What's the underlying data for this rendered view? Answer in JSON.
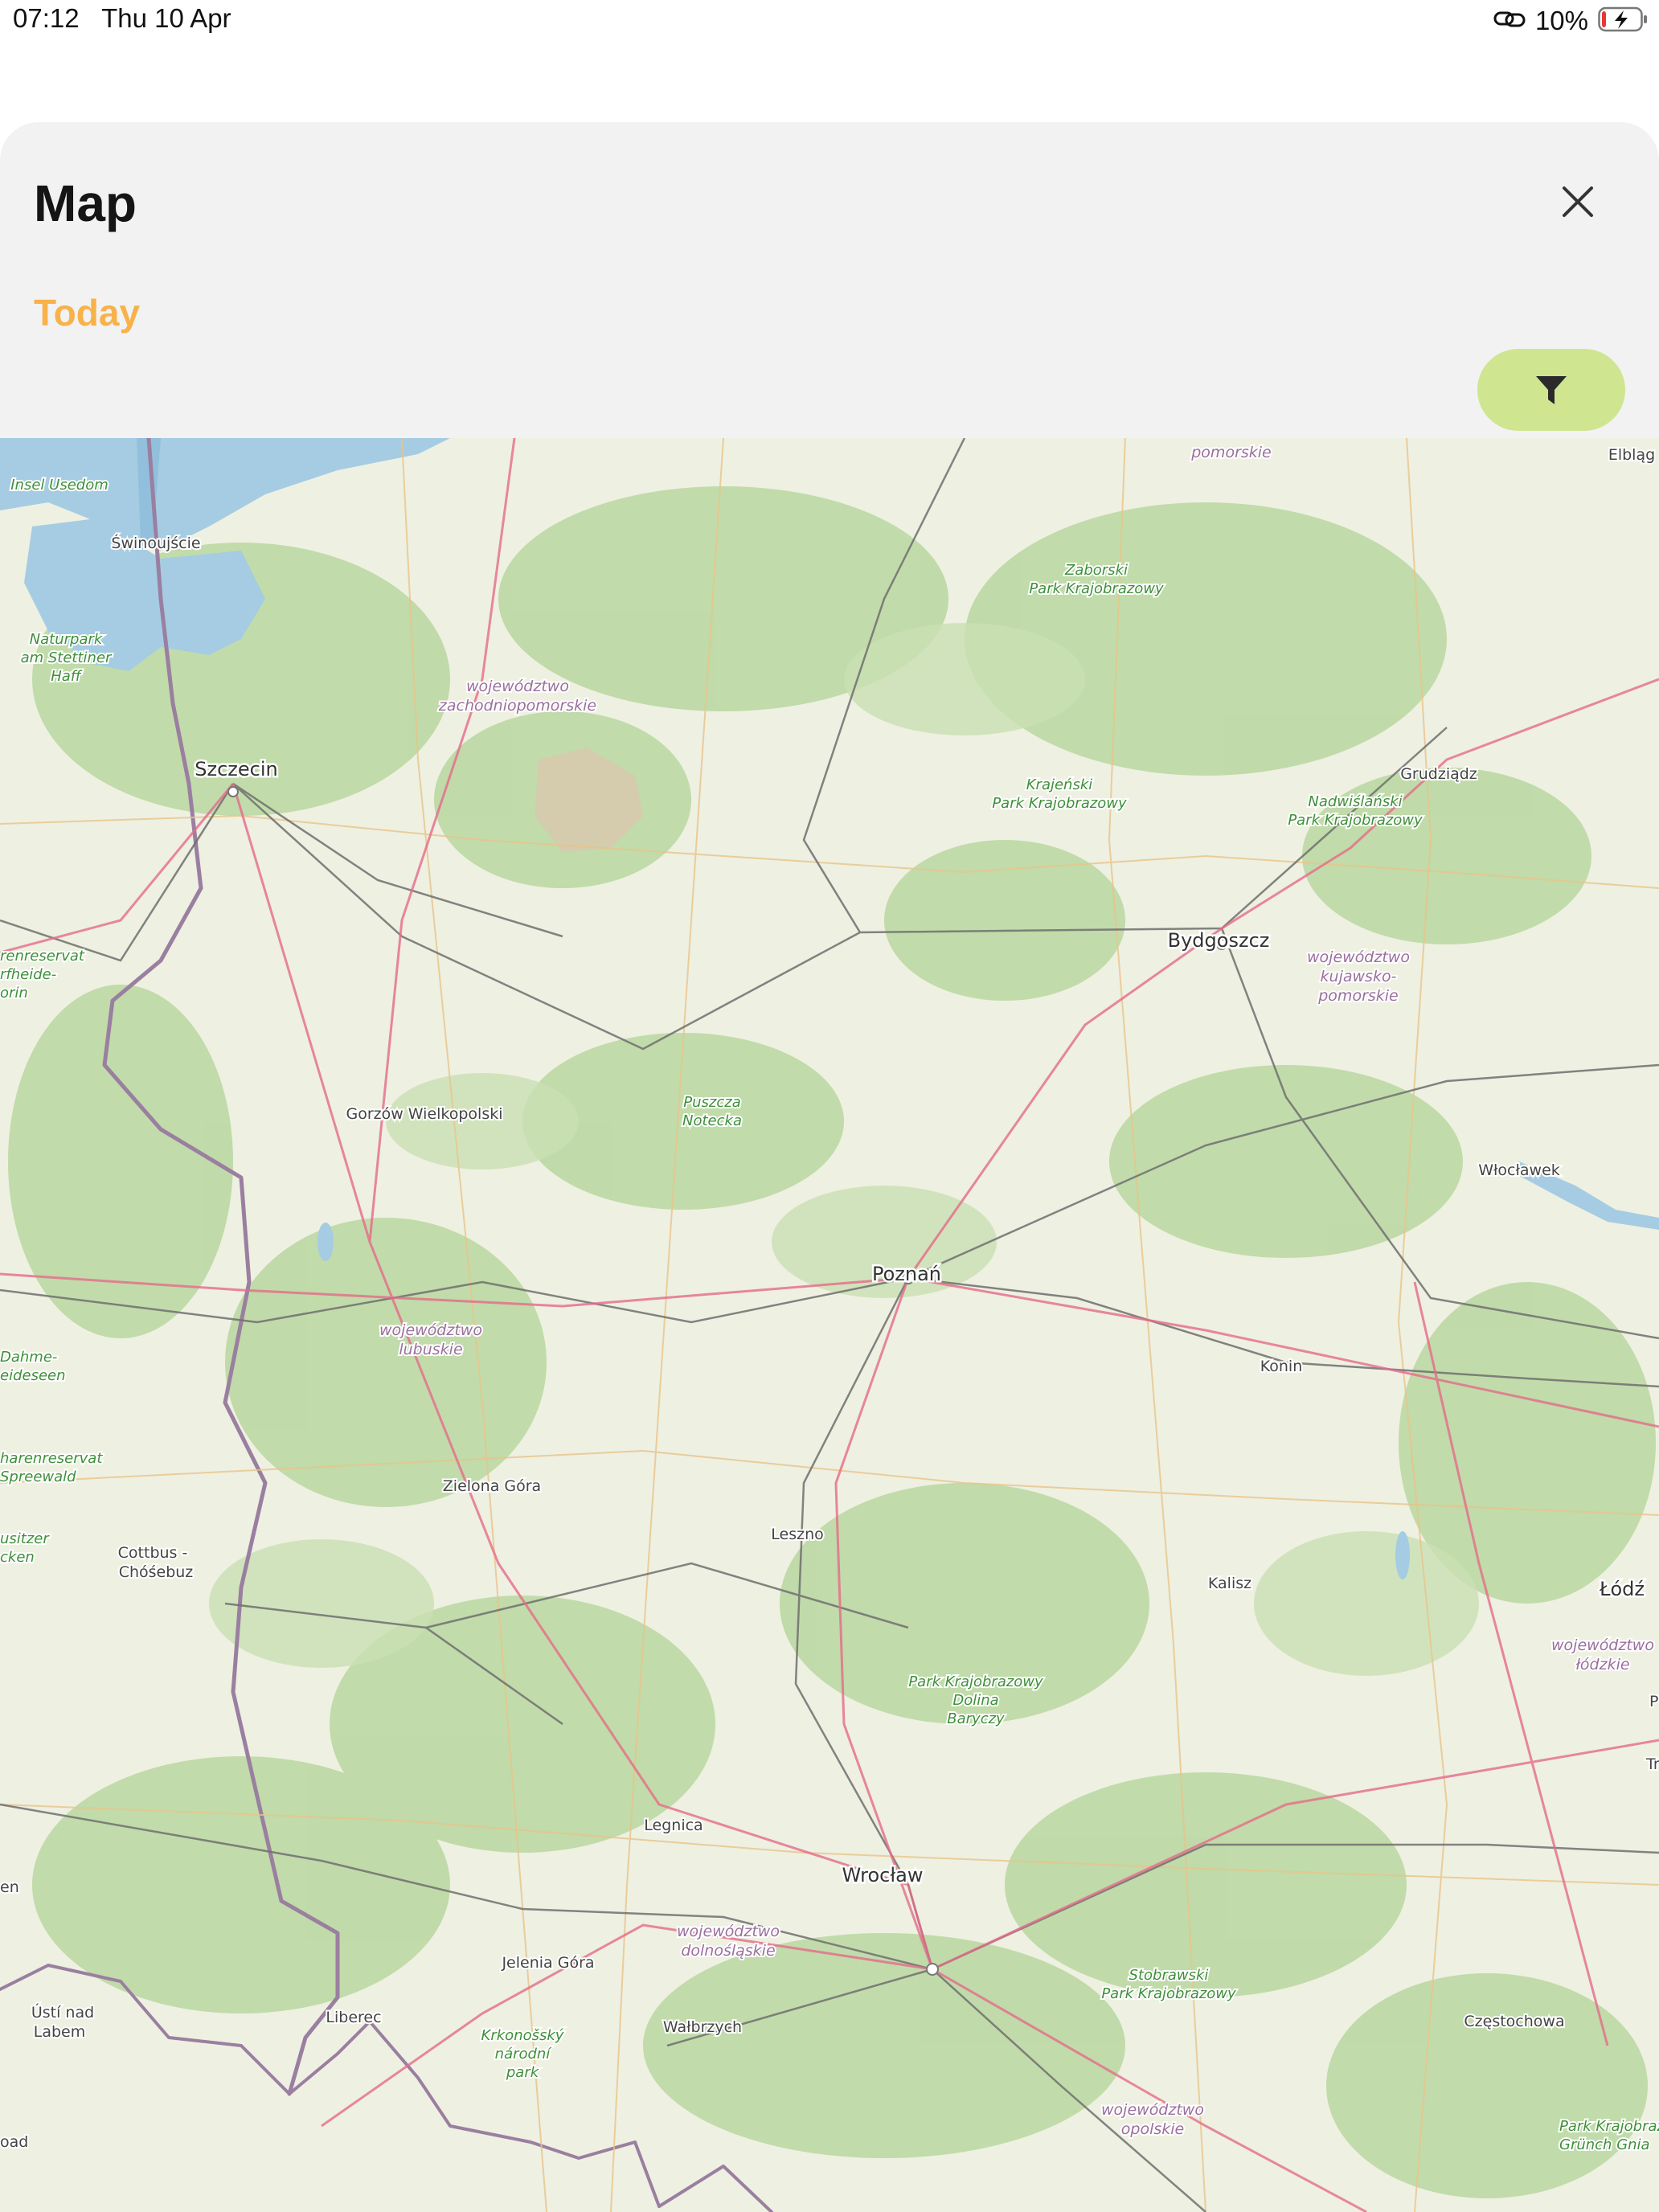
{
  "status_bar": {
    "time": "07:12",
    "date": "Thu 10 Apr",
    "battery_percent": "10%",
    "battery_level": 0.1,
    "charging": true
  },
  "sheet": {
    "title": "Map",
    "subtitle": "Today",
    "close_icon": "close-icon",
    "filter_icon": "funnel-icon",
    "accent_color": "#f7b24a",
    "filter_button_color": "#cfe58f"
  },
  "map": {
    "cities": {
      "swinoujscie": "Świnoujście",
      "szczecin": "Szczecin",
      "gorzow": "Gorzów Wielkopolski",
      "poznan": "Poznań",
      "bydgoszcz": "Bydgoszcz",
      "grudziadz": "Grudziądz",
      "wloclawek": "Włocławek",
      "konin": "Konin",
      "kalisz": "Kalisz",
      "lodz": "Łódź",
      "zielona_gora": "Zielona Góra",
      "leszno": "Leszno",
      "cottbus": "Cottbus -",
      "chosebuz": "Chóśebuz",
      "legnica": "Legnica",
      "wroclaw": "Wrocław",
      "jelenia_gora": "Jelenia Góra",
      "walbrzych": "Wałbrzych",
      "liberec": "Liberec",
      "usti1": "Ústí nad",
      "usti2": "Labem",
      "czestochowa": "Częstochowa",
      "elblag": "Elbląg"
    },
    "regions": {
      "zach1": "województwo",
      "zach2": "zachodniopomorskie",
      "lub1": "województwo",
      "lub2": "lubuskie",
      "kuj1": "województwo",
      "kuj2": "kujawsko-",
      "kuj3": "pomorskie",
      "dol1": "województwo",
      "dol2": "dolnośląskie",
      "opo1": "województwo",
      "opo2": "opolskie",
      "lodz1": "województwo",
      "lodz2": "łódzkie",
      "pomorskie": "pomorskie"
    },
    "parks": {
      "usedom": "Insel Usedom",
      "stett1": "Naturpark",
      "stett2": "am Stettiner",
      "stett3": "Haff",
      "zab1": "Zaborski",
      "zab2": "Park Krajobrazowy",
      "kraj1": "Krajeński",
      "kraj2": "Park Krajobrazowy",
      "nadw1": "Nadwiślański",
      "nadw2": "Park Krajobrazowy",
      "pusz1": "Puszcza",
      "pusz2": "Notecka",
      "bar1": "Park Krajobrazowy",
      "bar2": "Dolina",
      "bar3": "Baryczy",
      "krk1": "Krkonošský",
      "krk2": "národní",
      "krk3": "park",
      "stob1": "Stobrawski",
      "stob2": "Park Krajobrazowy",
      "oder1": "renreservat",
      "oder2": "rfheide-",
      "oder3": "orin",
      "dahme1": "Dahme-",
      "dahme2": "eideseen",
      "spree1": "harenreservat",
      "spree2": "Spreewald",
      "lausitz1": "usitzer",
      "lausitz2": "cken",
      "grun1": "Park Krajobrazo",
      "grun2": "Grünch Gnia"
    },
    "edge": {
      "en": "en",
      "ad": "oad",
      "p": "P",
      "tr": "Tr"
    }
  }
}
